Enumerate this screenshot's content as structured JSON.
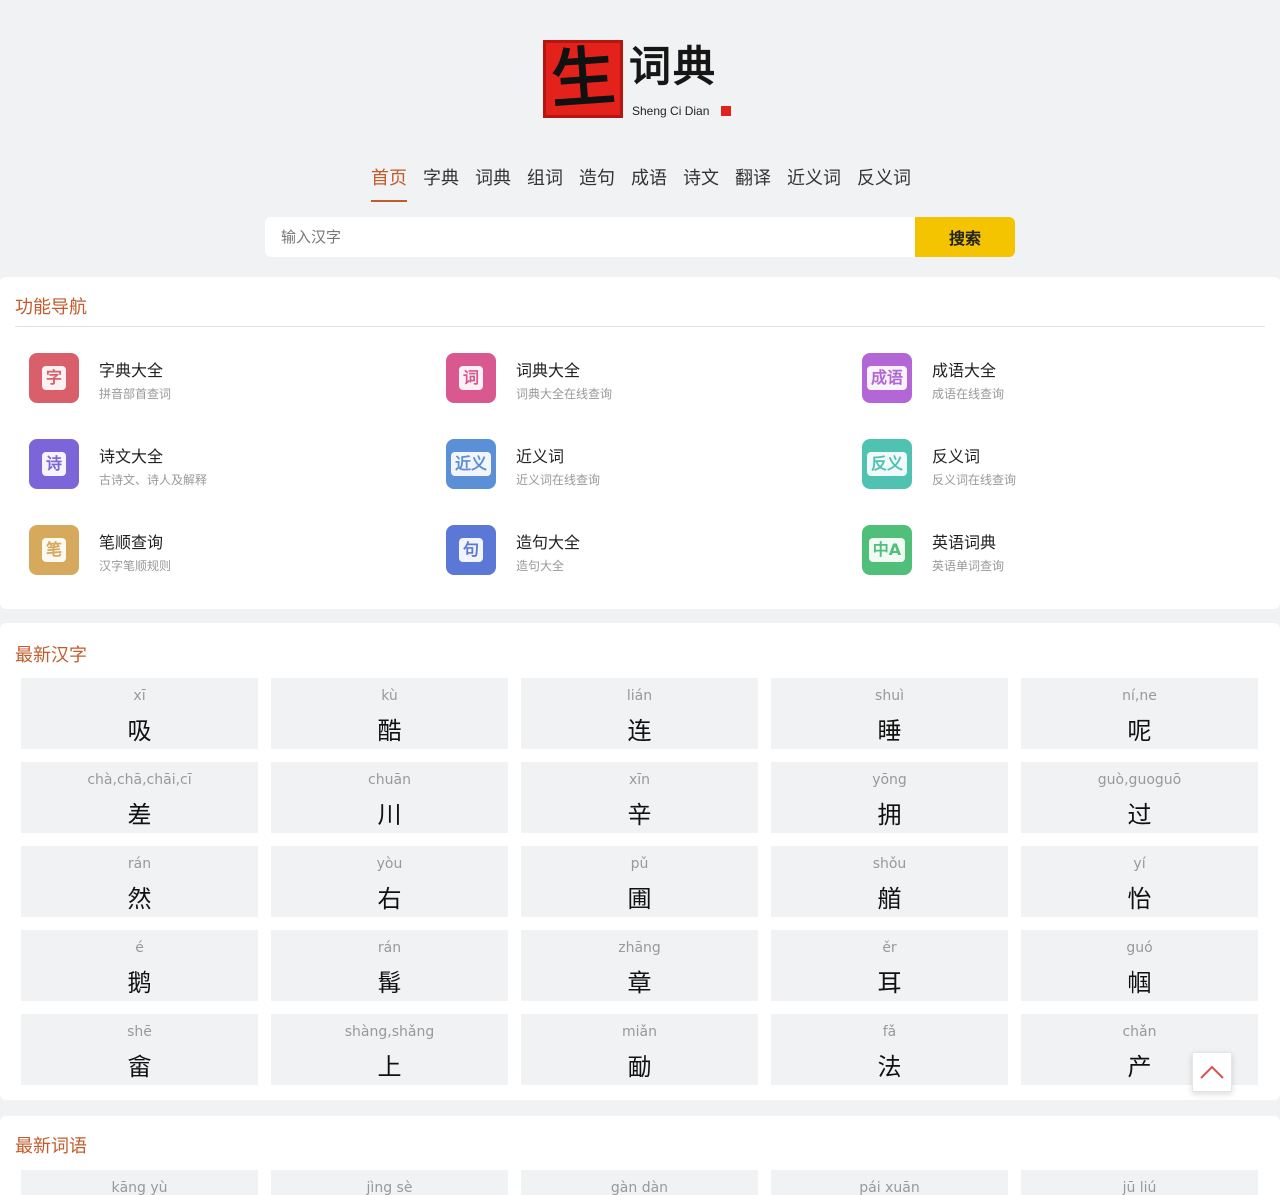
{
  "logo": {
    "seal_char": "生",
    "title": "词典",
    "subtitle": "Sheng Ci Dian"
  },
  "nav": [
    {
      "label": "首页",
      "active": true
    },
    {
      "label": "字典"
    },
    {
      "label": "词典"
    },
    {
      "label": "组词"
    },
    {
      "label": "造句"
    },
    {
      "label": "成语"
    },
    {
      "label": "诗文"
    },
    {
      "label": "翻译"
    },
    {
      "label": "近义词"
    },
    {
      "label": "反义词"
    }
  ],
  "search": {
    "placeholder": "输入汉字",
    "button": "搜索"
  },
  "features": {
    "title": "功能导航",
    "items": [
      {
        "icon_text": "字",
        "title": "字典大全",
        "desc": "拼音部首查词",
        "color": "#d9606b",
        "icon": "zidian-icon"
      },
      {
        "icon_text": "词",
        "title": "词典大全",
        "desc": "词典大全在线查询",
        "color": "#d9588f",
        "icon": "cidian-icon"
      },
      {
        "icon_text": "成语",
        "title": "成语大全",
        "desc": "成语在线查询",
        "color": "#b366d6",
        "icon": "chengyu-icon"
      },
      {
        "icon_text": "诗",
        "title": "诗文大全",
        "desc": "古诗文、诗人及解释",
        "color": "#7a66d8",
        "icon": "shiwen-icon"
      },
      {
        "icon_text": "近义",
        "title": "近义词",
        "desc": "近义词在线查询",
        "color": "#5b8fd6",
        "icon": "jinyici-icon"
      },
      {
        "icon_text": "反义",
        "title": "反义词",
        "desc": "反义词在线查询",
        "color": "#4fc2b2",
        "icon": "fanyici-icon"
      },
      {
        "icon_text": "笔",
        "title": "笔顺查询",
        "desc": "汉字笔顺规则",
        "color": "#d6a95c",
        "icon": "bishun-icon"
      },
      {
        "icon_text": "句",
        "title": "造句大全",
        "desc": "造句大全",
        "color": "#5b78d6",
        "icon": "zaoju-icon"
      },
      {
        "icon_text": "中A",
        "title": "英语词典",
        "desc": "英语单词查询",
        "color": "#4fbf7a",
        "icon": "yingyu-icon"
      }
    ]
  },
  "latest_chars": {
    "title": "最新汉字",
    "items": [
      {
        "py": "xī",
        "hz": "吸"
      },
      {
        "py": "kù",
        "hz": "酷"
      },
      {
        "py": "lián",
        "hz": "连"
      },
      {
        "py": "shuì",
        "hz": "睡"
      },
      {
        "py": "ní,ne",
        "hz": "呢"
      },
      {
        "py": "chà,chā,chāi,cī",
        "hz": "差"
      },
      {
        "py": "chuān",
        "hz": "川"
      },
      {
        "py": "xīn",
        "hz": "辛"
      },
      {
        "py": "yōng",
        "hz": "拥"
      },
      {
        "py": "guò,guoguō",
        "hz": "过"
      },
      {
        "py": "rán",
        "hz": "然"
      },
      {
        "py": "yòu",
        "hz": "右"
      },
      {
        "py": "pǔ",
        "hz": "圃"
      },
      {
        "py": "shǒu",
        "hz": "艏"
      },
      {
        "py": "yí",
        "hz": "怡"
      },
      {
        "py": "é",
        "hz": "鹅"
      },
      {
        "py": "rán",
        "hz": "髯"
      },
      {
        "py": "zhāng",
        "hz": "章"
      },
      {
        "py": "ěr",
        "hz": "耳"
      },
      {
        "py": "guó",
        "hz": "帼"
      },
      {
        "py": "shē",
        "hz": "畲"
      },
      {
        "py": "shàng,shǎng",
        "hz": "上"
      },
      {
        "py": "miǎn",
        "hz": "勔"
      },
      {
        "py": "fǎ",
        "hz": "法"
      },
      {
        "py": "chǎn",
        "hz": "产"
      }
    ]
  },
  "latest_words": {
    "title": "最新词语",
    "items": [
      {
        "py": "kāng yù"
      },
      {
        "py": "jìng sè"
      },
      {
        "py": "gàn dàn"
      },
      {
        "py": "pái xuān"
      },
      {
        "py": "jū liú"
      }
    ]
  }
}
